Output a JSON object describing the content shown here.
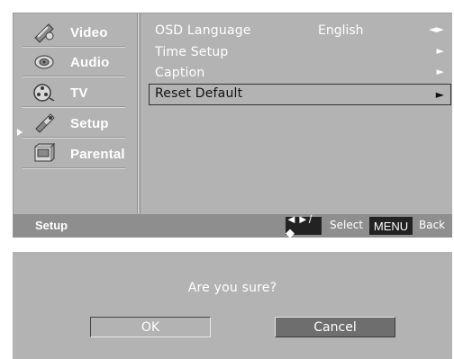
{
  "menu": {
    "items": [
      {
        "label": "Video",
        "icon": "video-icon"
      },
      {
        "label": "Audio",
        "icon": "audio-icon"
      },
      {
        "label": "TV",
        "icon": "tv-icon"
      },
      {
        "label": "Setup",
        "icon": "setup-icon",
        "selected": true
      },
      {
        "label": "Parental",
        "icon": "parental-icon"
      }
    ]
  },
  "options": [
    {
      "label": "OSD Language",
      "value": "English",
      "arrow": "◄►"
    },
    {
      "label": "Time Setup",
      "value": "",
      "arrow": "►"
    },
    {
      "label": "Caption",
      "value": "",
      "arrow": "►"
    },
    {
      "label": "Reset Default",
      "value": "",
      "arrow": "►",
      "selected": true
    }
  ],
  "footer": {
    "title": "Setup",
    "nav_key": "◄►/ ◆",
    "select_label": "Select",
    "menu_key": "MENU",
    "back_label": "Back"
  },
  "dialog": {
    "question": "Are you sure?",
    "ok_label": "OK",
    "cancel_label": "Cancel"
  },
  "colors": {
    "panel": "#b3b3b3",
    "footer": "#8e8e8e",
    "key_box": "#222222",
    "cancel_button": "#6e6e6e",
    "text": "#ffffff"
  }
}
